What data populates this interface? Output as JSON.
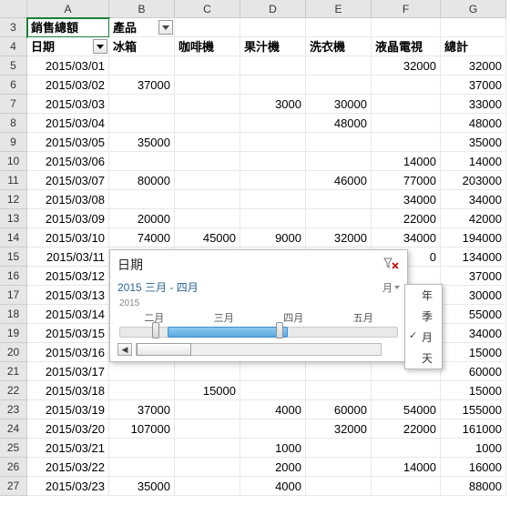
{
  "columns": [
    "A",
    "B",
    "C",
    "D",
    "E",
    "F",
    "G"
  ],
  "row_start": 3,
  "headers": {
    "pivot_label": "銷售總額",
    "product_label": "產品",
    "date_label": "日期",
    "products": [
      "冰箱",
      "咖啡機",
      "果汁機",
      "洗衣機",
      "液晶電視",
      "總計"
    ]
  },
  "rows": [
    {
      "date": "2015/03/01",
      "v": [
        "",
        "",
        "",
        "",
        "32000",
        "32000"
      ]
    },
    {
      "date": "2015/03/02",
      "v": [
        "37000",
        "",
        "",
        "",
        "",
        "37000"
      ]
    },
    {
      "date": "2015/03/03",
      "v": [
        "",
        "",
        "3000",
        "30000",
        "",
        "33000"
      ]
    },
    {
      "date": "2015/03/04",
      "v": [
        "",
        "",
        "",
        "48000",
        "",
        "48000"
      ]
    },
    {
      "date": "2015/03/05",
      "v": [
        "35000",
        "",
        "",
        "",
        "",
        "35000"
      ]
    },
    {
      "date": "2015/03/06",
      "v": [
        "",
        "",
        "",
        "",
        "14000",
        "14000"
      ]
    },
    {
      "date": "2015/03/07",
      "v": [
        "80000",
        "",
        "",
        "46000",
        "77000",
        "203000"
      ]
    },
    {
      "date": "2015/03/08",
      "v": [
        "",
        "",
        "",
        "",
        "34000",
        "34000"
      ]
    },
    {
      "date": "2015/03/09",
      "v": [
        "20000",
        "",
        "",
        "",
        "22000",
        "42000"
      ]
    },
    {
      "date": "2015/03/10",
      "v": [
        "74000",
        "45000",
        "9000",
        "32000",
        "34000",
        "194000"
      ]
    },
    {
      "date": "2015/03/11",
      "v": [
        "",
        "",
        "",
        "",
        "0",
        "134000"
      ]
    },
    {
      "date": "2015/03/12",
      "v": [
        "",
        "",
        "",
        "",
        "",
        "37000"
      ]
    },
    {
      "date": "2015/03/13",
      "v": [
        "",
        "",
        "",
        "",
        "",
        "30000"
      ]
    },
    {
      "date": "2015/03/14",
      "v": [
        "",
        "",
        "",
        "",
        "",
        "55000"
      ]
    },
    {
      "date": "2015/03/15",
      "v": [
        "",
        "",
        "",
        "",
        "",
        "34000"
      ]
    },
    {
      "date": "2015/03/16",
      "v": [
        "",
        "",
        "",
        "",
        "",
        "15000"
      ]
    },
    {
      "date": "2015/03/17",
      "v": [
        "",
        "",
        "",
        "",
        "",
        "60000"
      ]
    },
    {
      "date": "2015/03/18",
      "v": [
        "",
        "15000",
        "",
        "",
        "",
        "15000"
      ]
    },
    {
      "date": "2015/03/19",
      "v": [
        "37000",
        "",
        "4000",
        "60000",
        "54000",
        "155000"
      ]
    },
    {
      "date": "2015/03/20",
      "v": [
        "107000",
        "",
        "",
        "32000",
        "22000",
        "161000"
      ]
    },
    {
      "date": "2015/03/21",
      "v": [
        "",
        "",
        "1000",
        "",
        "",
        "1000"
      ]
    },
    {
      "date": "2015/03/22",
      "v": [
        "",
        "",
        "2000",
        "",
        "14000",
        "16000"
      ]
    },
    {
      "date": "2015/03/23",
      "v": [
        "35000",
        "",
        "4000",
        "",
        "",
        "88000"
      ]
    }
  ],
  "timeline": {
    "title": "日期",
    "range_text": "2015 三月 - 四月",
    "level_label": "月",
    "year_label": "2015",
    "months": [
      "二月",
      "三月",
      "四月",
      "五月"
    ],
    "scroll_left": "◀",
    "scroll_right": "▶",
    "level_menu": [
      "年",
      "季",
      "月",
      "天"
    ],
    "level_selected": "月"
  }
}
